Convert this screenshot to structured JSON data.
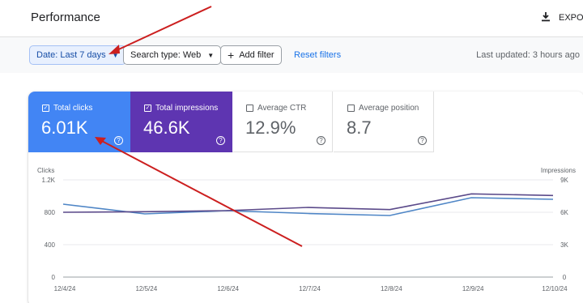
{
  "header": {
    "title": "Performance",
    "export_label": "EXPOR"
  },
  "filters": {
    "date_label": "Date: Last 7 days",
    "search_type_label": "Search type: Web",
    "add_filter_label": "Add filter",
    "reset_label": "Reset filters",
    "last_updated": "Last updated: 3 hours ago"
  },
  "metrics": [
    {
      "label": "Total clicks",
      "value": "6.01K",
      "selected": true,
      "color": "#4285f4"
    },
    {
      "label": "Total impressions",
      "value": "46.6K",
      "selected": true,
      "color": "#5e35b1"
    },
    {
      "label": "Average CTR",
      "value": "12.9%",
      "selected": false
    },
    {
      "label": "Average position",
      "value": "8.7",
      "selected": false
    }
  ],
  "chart_data": {
    "type": "line",
    "x": [
      "12/4/24",
      "12/5/24",
      "12/6/24",
      "12/7/24",
      "12/8/24",
      "12/9/24",
      "12/10/24"
    ],
    "left_axis": {
      "label": "Clicks",
      "ticks": [
        "1.2K",
        "800",
        "400",
        "0"
      ],
      "ylim": [
        0,
        1200
      ]
    },
    "right_axis": {
      "label": "Impressions",
      "ticks": [
        "9K",
        "6K",
        "3K",
        "0"
      ],
      "ylim": [
        0,
        9000
      ]
    },
    "grid": true,
    "series": [
      {
        "name": "Total clicks",
        "axis": "left",
        "color": "#4f86c6",
        "values": [
          900,
          780,
          820,
          785,
          760,
          980,
          960
        ]
      },
      {
        "name": "Total impressions",
        "axis": "right",
        "color": "#5b4a8a",
        "values": [
          6000,
          6050,
          6150,
          6450,
          6250,
          7700,
          7550
        ]
      }
    ]
  }
}
